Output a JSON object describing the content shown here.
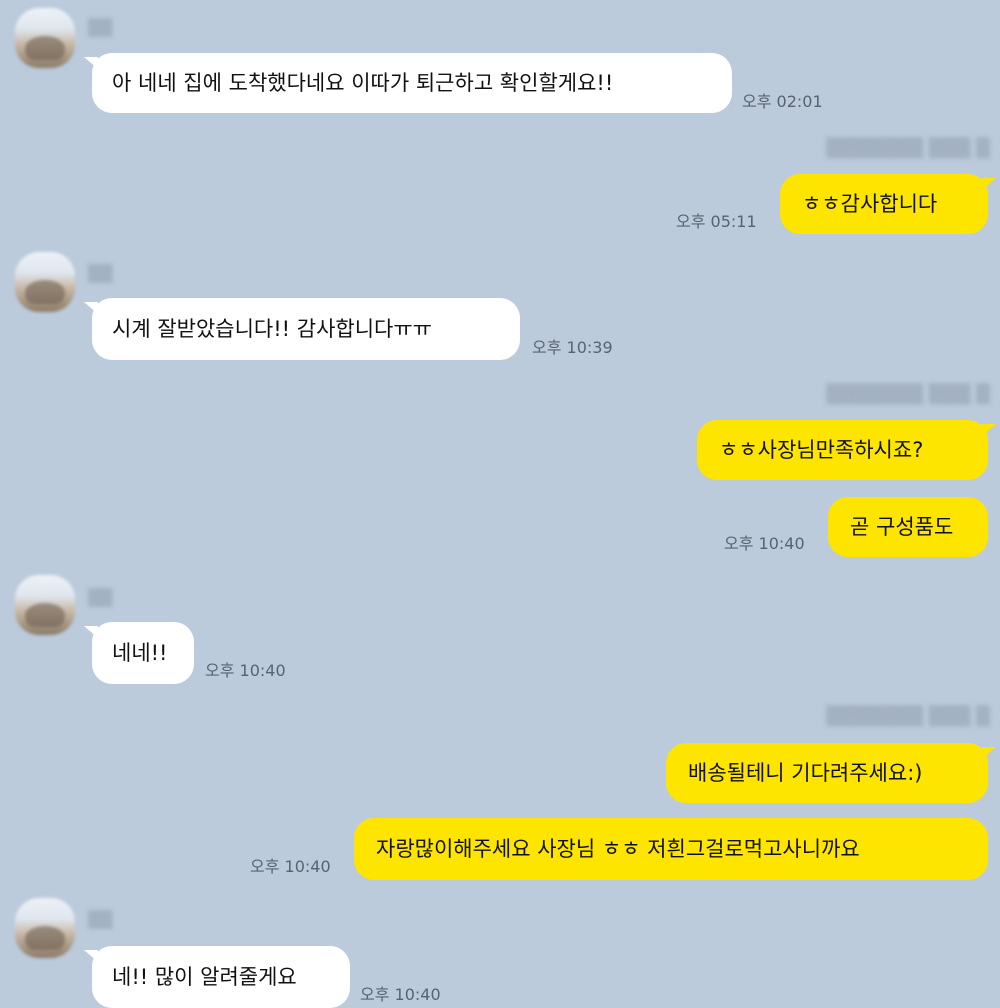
{
  "messages": [
    {
      "text": "아 네네 집에 도착했다네요 이따가 퇴근하고 확인할게요!!",
      "time": "오후 02:01"
    },
    {
      "text": "ㅎㅎ감사합니다",
      "time": "오후 05:11"
    },
    {
      "text": "시계 잘받았습니다!! 감사합니다ㅠㅠ",
      "time": "오후 10:39"
    },
    {
      "text": "ㅎㅎ사장님만족하시죠?"
    },
    {
      "text": "곧 구성품도",
      "time": "오후 10:40"
    },
    {
      "text": "네네!!",
      "time": "오후 10:40"
    },
    {
      "text": "배송될테니 기다려주세요:)"
    },
    {
      "text": "자랑많이해주세요 사장님 ㅎㅎ 저흰그걸로먹고사니까요",
      "time": "오후 10:40"
    },
    {
      "text": "네!! 많이 알려줄게요",
      "time": "오후 10:40"
    }
  ],
  "icons": {
    "avatar": "profile-avatar-blurred"
  }
}
